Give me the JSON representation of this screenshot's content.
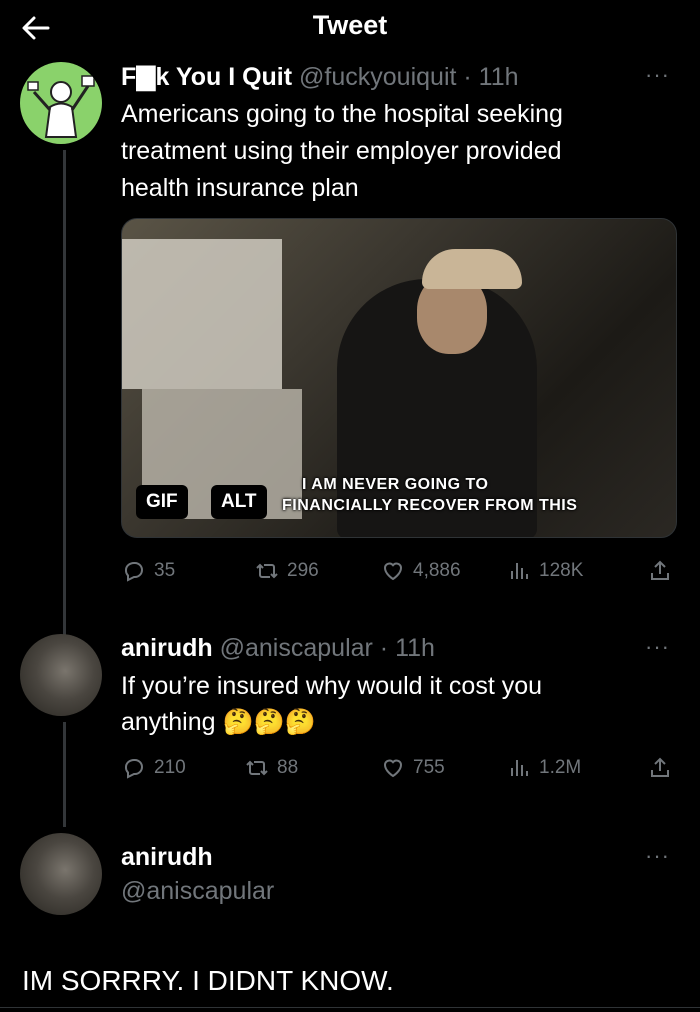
{
  "header": {
    "title": "Tweet"
  },
  "tweet1": {
    "author_name": "F▇k You I Quit",
    "handle_time": "@fuckyouiquit · 11h",
    "text_lines": [
      "Americans going to the hospital seeking",
      "treatment using their employer provided",
      "health insurance plan"
    ],
    "media": {
      "caption_line1": "I AM NEVER GOING TO",
      "caption_line2": "FINANCIALLY RECOVER FROM THIS",
      "gif_label": "GIF",
      "alt_label": "ALT"
    },
    "stats": {
      "replies": "35",
      "retweets": "296",
      "likes": "4,886",
      "views": "128K"
    }
  },
  "tweet2": {
    "author_name": "anirudh",
    "handle_time": "@aniscapular · 11h",
    "text_line1": "If you’re insured why would it cost you",
    "text_line2": "anything 🤔🤔🤔",
    "stats": {
      "replies": "210",
      "retweets": "88",
      "likes": "755",
      "views": "1.2M"
    }
  },
  "tweet3": {
    "author_name": "anirudh",
    "handle": "@aniscapular",
    "text": "IM SORRRY. I DIDNT KNOW."
  },
  "colors": {
    "background": "#000000",
    "text": "#e7e9ea",
    "muted": "#71767b",
    "avatar_green": "#8ad26b"
  },
  "icons": [
    "back-arrow-icon",
    "more-icon",
    "reply-icon",
    "retweet-icon",
    "like-icon",
    "views-icon",
    "share-icon"
  ]
}
